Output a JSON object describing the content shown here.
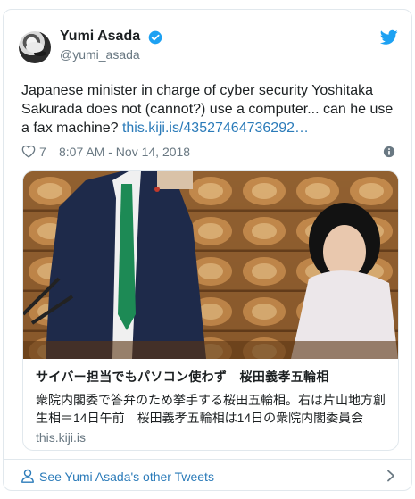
{
  "author": {
    "name": "Yumi Asada",
    "handle": "@yumi_asada"
  },
  "tweet": {
    "text": "Japanese minister in charge of cyber security Yoshitaka Sakurada does not (cannot?) use a computer... can he use a fax machine? ",
    "link_text": "this.kiji.is/43527464736292…",
    "likes": "7",
    "timestamp": "8:07 AM - Nov 14, 2018"
  },
  "card": {
    "title": "サイバー担当でもパソコン使わず　桜田義孝五輪相",
    "description": "衆院内閣委で答弁のため挙手する桜田五輪相。右は片山地方創生相＝14日午前　桜田義孝五輪相は14日の衆院内閣委員会",
    "domain": "this.kiji.is"
  },
  "footer": {
    "label": "See Yumi Asada's other Tweets"
  },
  "colors": {
    "link": "#2b7bb9",
    "muted": "#697882",
    "border": "#e1e8ed",
    "twitter_blue": "#1da1f2"
  },
  "icons": [
    "verified-badge-icon",
    "twitter-bird-icon",
    "heart-icon",
    "info-icon",
    "person-icon",
    "chevron-right-icon"
  ]
}
